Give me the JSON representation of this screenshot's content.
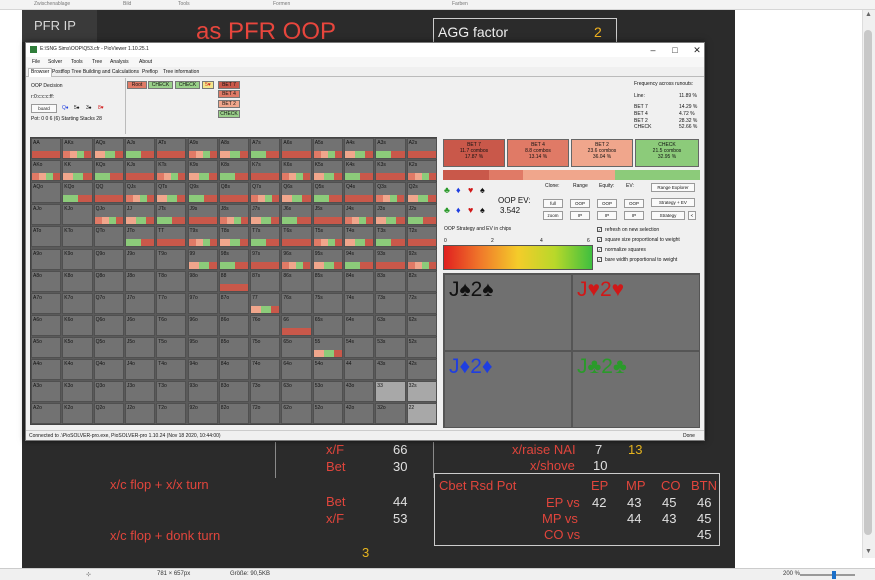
{
  "host": {
    "top_labels": [
      "Zwischenablage",
      "Bild",
      "Tools",
      "Formen",
      "Farben"
    ],
    "status": {
      "dims": "781 × 657px",
      "size": "Größe: 90,5KB",
      "zoom": "200 %"
    }
  },
  "slide": {
    "pfr_label": "PFR IP",
    "title": "as PFR OOP",
    "agg_label": "AGG factor",
    "agg_value": "2",
    "lower": {
      "row1": {
        "label": "x/F",
        "value": "66"
      },
      "row2": {
        "label": "Bet",
        "value": "30"
      },
      "xc_flop_xx_turn": "x/c flop + x/x turn",
      "row3": {
        "label": "Bet",
        "value": "44"
      },
      "row4": {
        "label": "x/F",
        "value": "53"
      },
      "xc_flop_donk_turn": "x/c flop + donk turn",
      "donk_value": "3",
      "raise_label": "x/raise NAI",
      "raise_v1": "7",
      "raise_v2": "13",
      "shove_label": "x/shove",
      "shove_value": "10"
    },
    "cbet_table": {
      "title": "Cbet Rsd Pot",
      "columns": [
        "EP",
        "MP",
        "CO",
        "BTN"
      ],
      "rows": [
        {
          "label": "EP vs",
          "values": [
            "42",
            "43",
            "45",
            "46"
          ]
        },
        {
          "label": "MP vs",
          "values": [
            "",
            "44",
            "43",
            "45"
          ]
        },
        {
          "label": "CO vs",
          "values": [
            "",
            "",
            "",
            "45"
          ]
        }
      ]
    }
  },
  "window": {
    "title": "E:\\SNG Sims\\OOP\\Q53.cfr - PioViewer 1.10.25.1",
    "menu": [
      "File",
      "Solver",
      "Tools",
      "Tree",
      "Analysis",
      "About"
    ],
    "tabs": [
      "Browser",
      "Postflop Tree Building and Calculations",
      "Preflop",
      "Tree information"
    ],
    "left_info": {
      "decision": "OOP Decision",
      "line": "r:0:c:c:c:ff:",
      "board_button": "board",
      "board_cards": [
        "Q♦",
        "5♠",
        "3♠",
        "8♥"
      ],
      "pot_stacks": "Pot: 0 0 6 (6) Starting Stacks 28"
    },
    "tree": {
      "row1": [
        "Root",
        "CHECK",
        "CHECK",
        "5♥"
      ],
      "bets": [
        "BET 7",
        "BET 4",
        "BET 2",
        "CHECK"
      ]
    },
    "freq_runouts": {
      "title": "Frequency across runouts:",
      "rows": [
        {
          "label": "Line:",
          "value": "11.89 %"
        },
        {
          "label": "BET 7",
          "value": "14.29 %"
        },
        {
          "label": "BET 4",
          "value": "4.72 %"
        },
        {
          "label": "BET 2",
          "value": "28.32 %"
        },
        {
          "label": "CHECK",
          "value": "52.66 %"
        }
      ]
    },
    "hands": [
      [
        "AA",
        "AKs",
        "AQs",
        "AJs",
        "ATs",
        "A9s",
        "A8s",
        "A7s",
        "A6s",
        "A5s",
        "A4s",
        "A3s",
        "A2s"
      ],
      [
        "AKo",
        "KK",
        "KQs",
        "KJs",
        "KTs",
        "K9s",
        "K8s",
        "K7s",
        "K6s",
        "K5s",
        "K4s",
        "K3s",
        "K2s"
      ],
      [
        "AQo",
        "KQo",
        "QQ",
        "QJs",
        "QTs",
        "Q9s",
        "Q8s",
        "Q7s",
        "Q6s",
        "Q5s",
        "Q4s",
        "Q3s",
        "Q2s"
      ],
      [
        "AJo",
        "KJo",
        "QJo",
        "JJ",
        "JTs",
        "J9s",
        "J8s",
        "J7s",
        "J6s",
        "J5s",
        "J4s",
        "J3s",
        "J2s"
      ],
      [
        "ATo",
        "KTo",
        "QTo",
        "JTo",
        "TT",
        "T9s",
        "T8s",
        "T7s",
        "T6s",
        "T5s",
        "T4s",
        "T3s",
        "T2s"
      ],
      [
        "A9o",
        "K9o",
        "Q9o",
        "J9o",
        "T9o",
        "99",
        "98s",
        "97s",
        "96s",
        "95s",
        "94s",
        "93s",
        "92s"
      ],
      [
        "A8o",
        "K8o",
        "Q8o",
        "J8o",
        "T8o",
        "98o",
        "88",
        "87s",
        "86s",
        "85s",
        "84s",
        "83s",
        "82s"
      ],
      [
        "A7o",
        "K7o",
        "Q7o",
        "J7o",
        "T7o",
        "97o",
        "87o",
        "77",
        "76s",
        "75s",
        "74s",
        "73s",
        "72s"
      ],
      [
        "A6o",
        "K6o",
        "Q6o",
        "J6o",
        "T6o",
        "96o",
        "86o",
        "76o",
        "66",
        "65s",
        "64s",
        "63s",
        "62s"
      ],
      [
        "A5o",
        "K5o",
        "Q5o",
        "J5o",
        "T5o",
        "95o",
        "85o",
        "75o",
        "65o",
        "55",
        "54s",
        "53s",
        "52s"
      ],
      [
        "A4o",
        "K4o",
        "Q4o",
        "J4o",
        "T4o",
        "94o",
        "84o",
        "74o",
        "64o",
        "54o",
        "44",
        "43s",
        "42s"
      ],
      [
        "A3o",
        "K3o",
        "Q3o",
        "J3o",
        "T3o",
        "93o",
        "83o",
        "73o",
        "63o",
        "53o",
        "43o",
        "33",
        "32s"
      ],
      [
        "A2o",
        "K2o",
        "Q2o",
        "J2o",
        "T2o",
        "92o",
        "82o",
        "72o",
        "62o",
        "52o",
        "42o",
        "32o",
        "22"
      ]
    ],
    "actions": [
      {
        "name": "BET 7",
        "combos": "11.7 combos",
        "pct": "17.87 %",
        "color": "#c9584a"
      },
      {
        "name": "BET 4",
        "combos": "8.8 combos",
        "pct": "13.14 %",
        "color": "#e07a66"
      },
      {
        "name": "BET 2",
        "combos": "23.6 combos",
        "pct": "36.04 %",
        "color": "#f0a68c"
      },
      {
        "name": "CHECK",
        "combos": "21.5 combos",
        "pct": "32.95 %",
        "color": "#8ccb7a"
      }
    ],
    "controls": {
      "headers": [
        "Clone:",
        "Range",
        "Equity:",
        "EV:"
      ],
      "oop_ev_label": "OOP EV:",
      "oop_ev_value": "3.542",
      "row1": [
        "full",
        "OOP",
        "OOP",
        "OOP"
      ],
      "row2": [
        "zoom",
        "IP",
        "IP",
        "IP"
      ],
      "right_buttons": [
        "Range Explorer",
        "Strategy + EV",
        "Strategy",
        "<"
      ],
      "strategy_label": "OOP Strategy and EV in chips",
      "scale": [
        "0",
        "2",
        "4",
        "6"
      ],
      "checkboxes": [
        "refresh on new selection",
        "square size proportional to weight",
        "normalize squares",
        "bare width proportional to weight"
      ]
    },
    "boards": [
      {
        "text": "J♠2♠",
        "color": "#111111"
      },
      {
        "text": "J♥2♥",
        "color": "#d01818"
      },
      {
        "text": "J♦2♦",
        "color": "#1f3ee0"
      },
      {
        "text": "J♣2♣",
        "color": "#2a9a2a"
      }
    ],
    "status_left": "Connected to .\\PioSOLVER-pro.exe, PioSOLVER-pro 1.10.24 (Nov 18 2020, 10:44:00)",
    "status_right": "Done"
  }
}
